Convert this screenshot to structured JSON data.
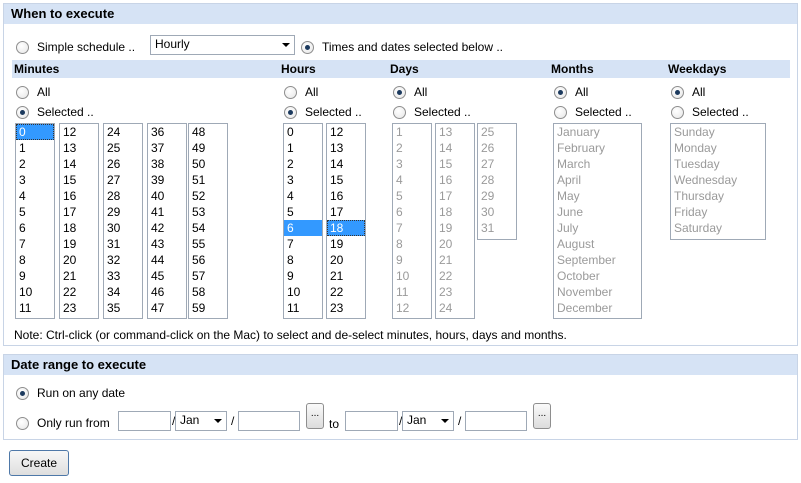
{
  "when": {
    "header": "When to execute",
    "simple_label": "Simple schedule ..",
    "simple_value": "Hourly",
    "times_label": "Times and dates selected below .."
  },
  "columns": {
    "minutes": {
      "title": "Minutes",
      "all": "All",
      "selected": "Selected ..",
      "lists": [
        [
          "0",
          "1",
          "2",
          "3",
          "4",
          "5",
          "6",
          "7",
          "8",
          "9",
          "10",
          "11"
        ],
        [
          "12",
          "13",
          "14",
          "15",
          "16",
          "17",
          "18",
          "19",
          "20",
          "21",
          "22",
          "23"
        ],
        [
          "24",
          "25",
          "26",
          "27",
          "28",
          "29",
          "30",
          "31",
          "32",
          "33",
          "34",
          "35"
        ],
        [
          "36",
          "37",
          "38",
          "39",
          "40",
          "41",
          "42",
          "43",
          "44",
          "45",
          "46",
          "47"
        ],
        [
          "48",
          "49",
          "50",
          "51",
          "52",
          "53",
          "54",
          "55",
          "56",
          "57",
          "58",
          "59"
        ]
      ]
    },
    "hours": {
      "title": "Hours",
      "all": "All",
      "selected": "Selected ..",
      "lists": [
        [
          "0",
          "1",
          "2",
          "3",
          "4",
          "5",
          "6",
          "7",
          "8",
          "9",
          "10",
          "11"
        ],
        [
          "12",
          "13",
          "14",
          "15",
          "16",
          "17",
          "18",
          "19",
          "20",
          "21",
          "22",
          "23"
        ]
      ]
    },
    "days": {
      "title": "Days",
      "all": "All",
      "selected": "Selected ..",
      "lists": [
        [
          "1",
          "2",
          "3",
          "4",
          "5",
          "6",
          "7",
          "8",
          "9",
          "10",
          "11",
          "12"
        ],
        [
          "13",
          "14",
          "15",
          "16",
          "17",
          "18",
          "19",
          "20",
          "21",
          "22",
          "23",
          "24"
        ],
        [
          "25",
          "26",
          "27",
          "28",
          "29",
          "30",
          "31"
        ]
      ]
    },
    "months": {
      "title": "Months",
      "all": "All",
      "selected": "Selected ..",
      "list": [
        "January",
        "February",
        "March",
        "April",
        "May",
        "June",
        "July",
        "August",
        "September",
        "October",
        "November",
        "December"
      ]
    },
    "weekdays": {
      "title": "Weekdays",
      "all": "All",
      "selected": "Selected ..",
      "list": [
        "Sunday",
        "Monday",
        "Tuesday",
        "Wednesday",
        "Thursday",
        "Friday",
        "Saturday"
      ]
    }
  },
  "note": "Note: Ctrl-click (or command-click on the Mac) to select and de-select minutes, hours, days and months.",
  "range": {
    "header": "Date range to execute",
    "any_label": "Run on any date",
    "only_label": "Only run from",
    "from_month": "Jan",
    "to_month": "Jan",
    "slash": "/",
    "to_label": "to",
    "picker_label": "..."
  },
  "create_label": "Create"
}
